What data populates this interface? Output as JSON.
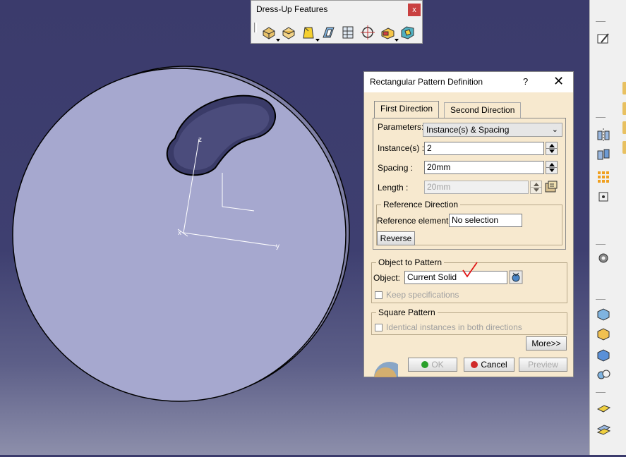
{
  "toolbar": {
    "title": "Dress-Up Features",
    "close_label": "x",
    "icons": [
      "fillet-icon",
      "chamfer-icon",
      "draft-icon",
      "shell-icon",
      "thickness-icon",
      "thread-icon",
      "remove-face-icon",
      "replace-face-icon"
    ]
  },
  "dialog": {
    "title": "Rectangular Pattern Definition",
    "help_label": "?",
    "close_label": "✕",
    "tabs": [
      {
        "label": "First Direction",
        "active": true
      },
      {
        "label": "Second Direction",
        "active": false
      }
    ],
    "parameters_label": "Parameters:",
    "parameters_value": "Instance(s) & Spacing",
    "instances_label": "Instance(s) :",
    "instances_value": "2",
    "spacing_label": "Spacing :",
    "spacing_value": "20mm",
    "length_label": "Length :",
    "length_value": "20mm",
    "reference_direction": {
      "legend": "Reference Direction",
      "element_label": "Reference element:",
      "element_value": "No selection",
      "reverse_label": "Reverse"
    },
    "object_to_pattern": {
      "legend": "Object to Pattern",
      "object_label": "Object:",
      "object_value": "Current Solid",
      "keep_specs_label": "Keep specifications"
    },
    "square_pattern": {
      "legend": "Square Pattern",
      "identical_label": "Identical instances in both directions"
    },
    "more_label": "More>>",
    "ok_label": "OK",
    "cancel_label": "Cancel",
    "preview_label": "Preview"
  },
  "axes": {
    "z": "z",
    "x": "x",
    "y": "y"
  },
  "colors": {
    "viewport_bg": "#3e3f70",
    "part_face": "#a6a8cf",
    "dialog_bg": "#f7e9cf",
    "annotation_check": "#e01818"
  }
}
